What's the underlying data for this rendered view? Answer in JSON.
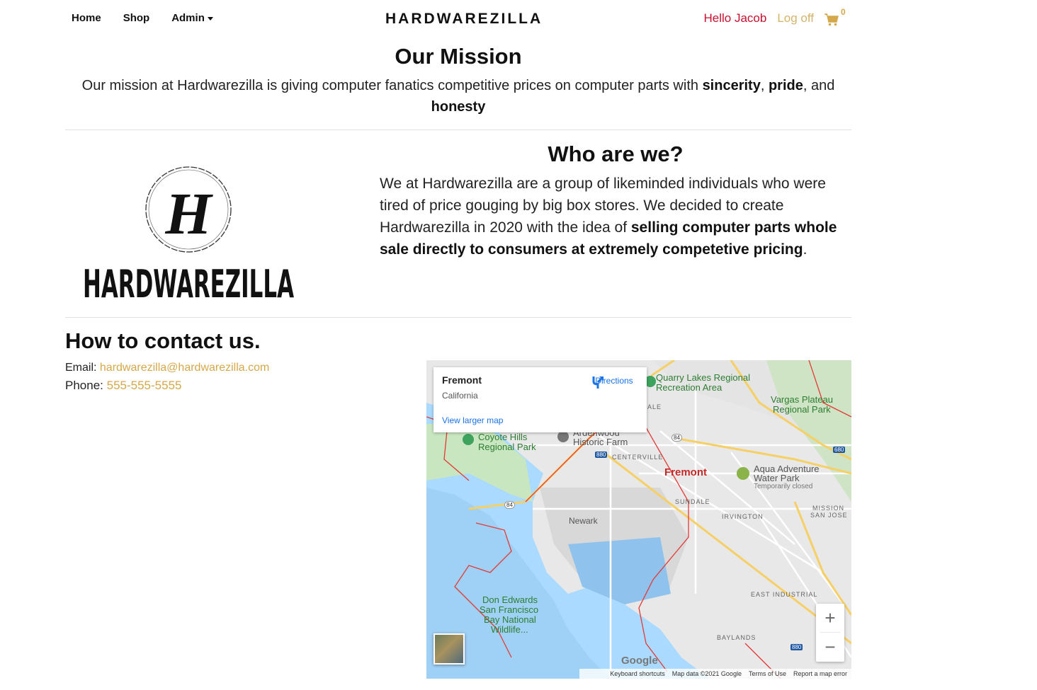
{
  "nav": {
    "home": "Home",
    "shop": "Shop",
    "admin": "Admin",
    "brand": "HARDWAREZILLA",
    "hello": "Hello Jacob",
    "logoff": "Log off",
    "cart_count": "0",
    "cart_icon": "shopping-cart-icon"
  },
  "mission": {
    "title": "Our Mission",
    "text_before": "Our mission at Hardwarezilla is giving computer fanatics competitive prices on computer parts with ",
    "w1": "sincerity",
    "sep1": ", ",
    "w2": "pride",
    "sep2": ", and ",
    "w3": "honesty"
  },
  "logo": {
    "monogram": "H",
    "wordmark": "HARDWAREZILLA"
  },
  "who": {
    "title": "Who are we?",
    "text": "We at Hardwarezilla are a group of likeminded individuals who were tired of price gouging by big box stores. We decided to create Hardwarezilla in 2020 with the idea of ",
    "bold": "selling computer parts whole sale directly to consumers at extremely competetive pricing",
    "end": "."
  },
  "contact": {
    "title": "How to contact us.",
    "email_label": "Email: ",
    "email": "hardwarezilla@hardwarezilla.com",
    "phone_label": "Phone: ",
    "phone": "555-555-5555"
  },
  "map": {
    "place": "Fremont",
    "region": "California",
    "directions": "Directions",
    "larger": "View larger map",
    "labels": {
      "quarry": "Quarry Lakes Regional",
      "quarry2": "Recreation Area",
      "vargas": "Vargas Plateau",
      "vargas2": "Regional Park",
      "coyote": "Coyote Hills",
      "coyote2": "Regional Park",
      "ardenwood": "Ardenwood",
      "ardenwood2": "Historic Farm",
      "centerville": "CENTERVILLE",
      "fremont": "Fremont",
      "aqua": "Aqua Adventure",
      "aqua2": "Water Park",
      "aqua3": "Temporarily closed",
      "sundale": "SUNDALE",
      "irvington": "IRVINGTON",
      "mission": "MISSION",
      "mission2": "SAN JOSE",
      "newark": "Newark",
      "east_ind": "EAST INDUSTRIAL",
      "baylands": "BAYLANDS",
      "donedwards": "Don Edwards",
      "donedwards2": "San Francisco",
      "donedwards3": "Bay National",
      "donedwards4": "Wildlife...",
      "ale": "ALE",
      "r84a": "84",
      "r84b": "84",
      "r880a": "880",
      "r880b": "880",
      "r680": "680"
    },
    "google": "Google",
    "footer": {
      "shortcuts": "Keyboard shortcuts",
      "data": "Map data ©2021 Google",
      "terms": "Terms of Use",
      "report": "Report a map error"
    }
  },
  "colors": {
    "accent": "#d4a84b",
    "hello": "#c8102e"
  }
}
